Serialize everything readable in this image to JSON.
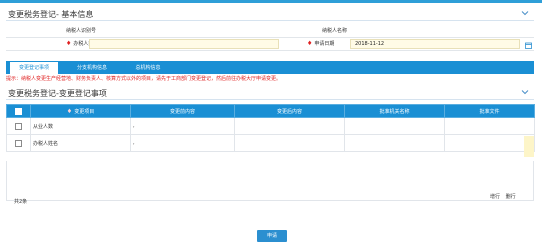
{
  "colors": {
    "accent": "#1a8fd4",
    "required": "#e02020",
    "value_bg": "#fffbe6"
  },
  "basic_panel": {
    "title": "变更税务登记- 基本信息",
    "taxpayer_id_label": "纳税人识别号",
    "taxpayer_id_value": "",
    "taxpayer_name_label": "纳税人名称",
    "taxpayer_name_value": "",
    "operator_label": "办税人姓名",
    "operator_value": "",
    "apply_date_label": "申请日期",
    "apply_date_value": "2018-11-12"
  },
  "tabs": [
    {
      "label": "变更登记事项"
    },
    {
      "label": "分支机构信息"
    },
    {
      "label": "总机构信息"
    }
  ],
  "notice": "提示：纳税人变更生产经营地、财务负责人、核算方式以外的项目，请先于工商部门变更登记，然后前往办税大厅申请变更。",
  "items_panel": {
    "title": "变更税务登记-变更登记事项",
    "columns": [
      "变更项目",
      "变更前内容",
      "变更后内容",
      "批准机关名称",
      "批准文件"
    ],
    "rows": [
      {
        "item": "从业人数",
        "before": "",
        "after": "",
        "authority": "",
        "document": ""
      },
      {
        "item": "办税人姓名",
        "before": "",
        "after": "",
        "authority": "",
        "document": ""
      }
    ],
    "count": "共2条",
    "add_row": "增行",
    "delete_row": "删行"
  },
  "submit_label": "申请"
}
